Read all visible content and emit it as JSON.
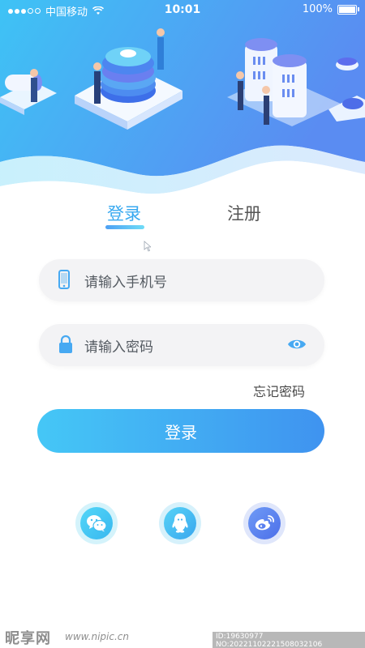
{
  "status_bar": {
    "carrier": "中国移动",
    "time": "10:01",
    "battery": "100%",
    "battery_level": 1.0
  },
  "tabs": {
    "login": "登录",
    "register": "注册",
    "active": "login"
  },
  "fields": {
    "phone_placeholder": "请输入手机号",
    "password_placeholder": "请输入密码"
  },
  "forgot_password": "忘记密码",
  "login_button": "登录",
  "social": {
    "wechat_icon": "wechat-icon",
    "qq_icon": "qq-icon",
    "weibo_icon": "weibo-icon"
  },
  "watermark": {
    "logo": "昵享网",
    "url": "www.nipic.cn",
    "id": "ID:19630977 NO:20221102221508032106"
  },
  "colors": {
    "accent": "#38a9f0",
    "button_start": "#45c7f6",
    "button_end": "#3f93f0",
    "hero_start": "#3ec3f5",
    "hero_end": "#5a8cf2"
  }
}
